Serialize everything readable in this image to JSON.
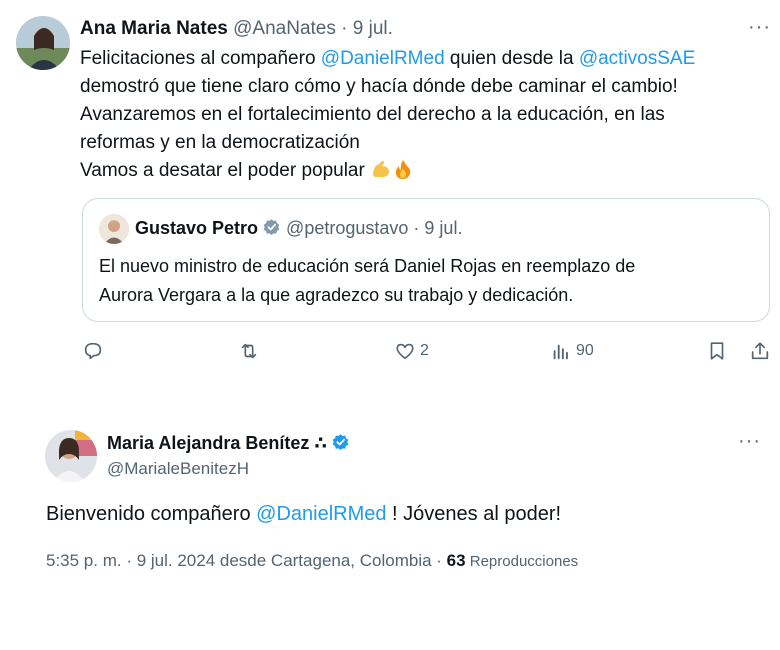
{
  "tweet1": {
    "author_name": "Ana Maria Nates",
    "handle": "@AnaNates",
    "separator": "·",
    "date": "9 jul.",
    "more_label": "···",
    "text": {
      "l1_a": "Felicitaciones al compañero ",
      "l1_mention1": "@DanielRMed",
      "l1_b": " quien desde la ",
      "l1_mention2": "@activosSAE",
      "l2": "demostró que tiene claro cómo y hacía dónde debe caminar el cambio!",
      "l3": "Avanzaremos en el fortalecimiento del derecho a la educación, en las",
      "l4": "reformas y en la democratización",
      "l5": "Vamos a desatar el poder popular "
    },
    "emojis": [
      "flexed-biceps-icon",
      "fire-icon"
    ],
    "quote": {
      "author_name": "Gustavo Petro",
      "handle": "@petrogustavo",
      "separator": "·",
      "date": "9 jul.",
      "l1": "El nuevo ministro de educación será Daniel Rojas en reemplazo de",
      "l2": "Aurora Vergara a la que agradezco su trabajo y dedicación."
    },
    "actions": {
      "likes": "2",
      "views": "90"
    }
  },
  "tweet2": {
    "author_name": "Maria Alejandra Benítez ∴",
    "handle": "@MarialeBenitezH",
    "more_label": "···",
    "text_a": "Bienvenido compañero ",
    "text_mention": "@DanielRMed",
    "text_b": " ! Jóvenes al poder!",
    "meta_time": "5:35 p. m. · 9 jul. 2024 desde Cartagena, Colombia · ",
    "meta_views": "63",
    "meta_views_label": " Reproducciones"
  },
  "colors": {
    "accent": "#1d9bf0",
    "muted": "#536471",
    "border": "#cfd9de"
  }
}
